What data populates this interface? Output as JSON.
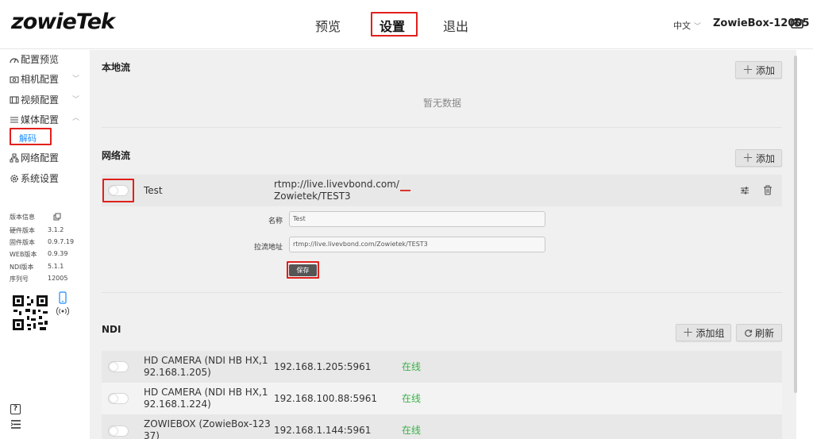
{
  "header": {
    "logo": "zowieTek",
    "nav": [
      "预览",
      "设置",
      "退出"
    ],
    "language": "中文",
    "device_name": "ZowieBox-12005"
  },
  "sidebar": {
    "items": [
      {
        "label": "配置预览",
        "icon": "preview-icon"
      },
      {
        "label": "相机配置",
        "icon": "camera-icon"
      },
      {
        "label": "视频配置",
        "icon": "film-icon"
      },
      {
        "label": "媒体配置",
        "icon": "media-icon"
      },
      {
        "label": "网络配置",
        "icon": "network-icon"
      },
      {
        "label": "系统设置",
        "icon": "gear-icon"
      }
    ],
    "sub_item": "解码",
    "version_title": "版本信息",
    "versions": [
      {
        "label": "硬件版本",
        "value": "3.1.2"
      },
      {
        "label": "固件版本",
        "value": "0.9.7.19"
      },
      {
        "label": "WEB版本",
        "value": "0.9.39"
      },
      {
        "label": "NDI版本",
        "value": "5.1.1"
      },
      {
        "label": "序列号",
        "value": "12005"
      }
    ]
  },
  "main": {
    "local_stream": {
      "title": "本地流",
      "add_label": "添加",
      "empty_text": "暂无数据"
    },
    "network_stream": {
      "title": "网络流",
      "add_label": "添加",
      "row": {
        "name": "Test",
        "url_line1": "rtmp://live.livevbond.com/",
        "url_line2": "Zowietek/TEST3"
      },
      "form": {
        "name_label": "名称",
        "name_value": "Test",
        "url_label": "拉流地址",
        "url_value": "rtmp://live.livevbond.com/Zowietek/TEST3",
        "save_label": "保存"
      }
    },
    "ndi": {
      "title": "NDI",
      "add_group_label": "添加组",
      "refresh_label": "刷新",
      "rows": [
        {
          "name_line1": "HD CAMERA (NDI HB HX,1",
          "name_line2": "92.168.1.205)",
          "address": "192.168.1.205:5961",
          "status": "在线"
        },
        {
          "name_line1": "HD CAMERA (NDI HB HX,1",
          "name_line2": "92.168.1.224)",
          "address": "192.168.100.88:5961",
          "status": "在线"
        },
        {
          "name_line1": "ZOWIEBOX (ZowieBox-123",
          "name_line2": "37)",
          "address": "192.168.1.144:5961",
          "status": "在线"
        }
      ]
    }
  },
  "colors": {
    "highlight_border": "#e0201c",
    "online": "#3bb04a",
    "link_blue": "#1a8cff"
  }
}
